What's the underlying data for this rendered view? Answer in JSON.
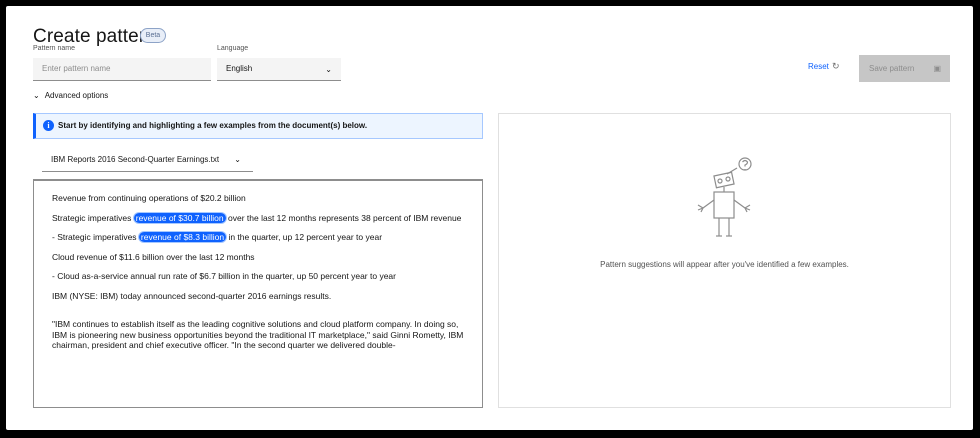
{
  "header": {
    "title": "Create pattern",
    "badge": "Beta"
  },
  "form": {
    "pattern_name_label": "Pattern name",
    "pattern_name_placeholder": "Enter pattern name",
    "language_label": "Language",
    "language_value": "English",
    "advanced_options": "Advanced options"
  },
  "actions": {
    "reset": "Reset",
    "save": "Save pattern"
  },
  "notification": {
    "text": "Start by identifying and highlighting a few examples from the document(s) below."
  },
  "document": {
    "selected_file": "IBM Reports 2016 Second-Quarter Earnings.txt",
    "paragraphs": {
      "p1": "Revenue from continuing operations of $20.2 billion",
      "p2_before": "Strategic imperatives ",
      "p2_highlight": "revenue of $30.7 billion",
      "p2_after": " over the last 12 months represents 38 percent of IBM revenue",
      "p3_before": "- Strategic imperatives ",
      "p3_highlight": "revenue of $8.3 billion",
      "p3_after": " in the quarter, up 12 percent year to year",
      "p4": "Cloud revenue of $11.6 billion over the last 12 months",
      "p5": "- Cloud as-a-service annual run rate of $6.7 billion in the quarter, up 50 percent year to year",
      "p6": "IBM (NYSE: IBM) today announced second-quarter 2016 earnings results.",
      "p7": "\"IBM continues to establish itself as the leading cognitive solutions and cloud platform company. In doing so, IBM is pioneering new business opportunities beyond the traditional IT marketplace,\" said Ginni Rometty, IBM chairman, president and chief executive officer. \"In the second quarter we delivered double-"
    }
  },
  "suggestions": {
    "empty_text": "Pattern suggestions will appear after you've identified a few examples."
  },
  "icons": {
    "info": "info-icon",
    "reset": "reset-icon",
    "save": "save-icon",
    "chevron": "chevron-down-icon",
    "robot": "robot-illustration"
  },
  "colors": {
    "accent": "#0f62fe",
    "highlight": "#0f62fe",
    "disabled_button": "#c6c6c6"
  }
}
